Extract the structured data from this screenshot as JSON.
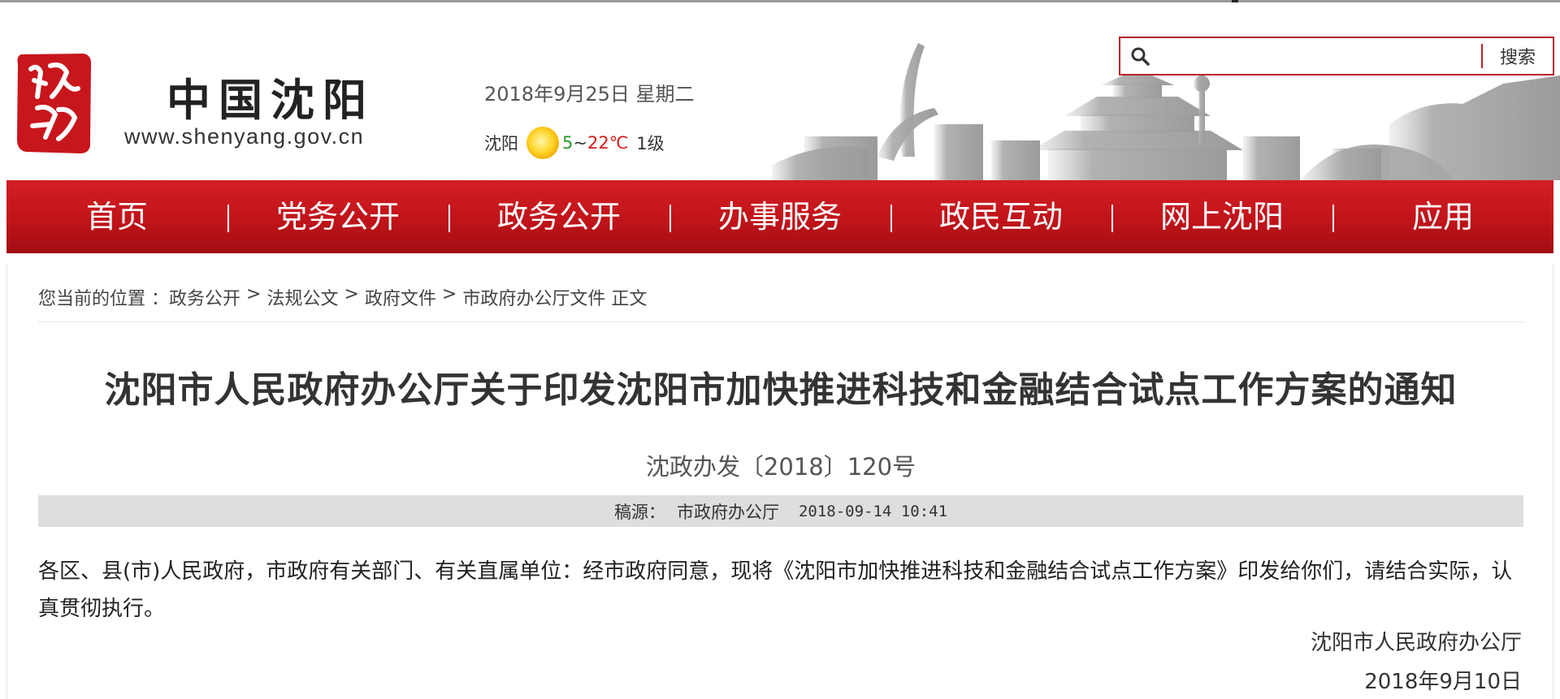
{
  "header": {
    "site_name": "中国沈阳",
    "site_url": "www.shenyang.gov.cn",
    "date": "2018年9月25日 星期二",
    "weather": {
      "city": "沈阳",
      "icon": "sun-icon",
      "temp_low": "5",
      "temp_sep": "~",
      "temp_high": "22℃",
      "wind": "1级"
    },
    "search": {
      "placeholder": "",
      "button_label": "搜索"
    }
  },
  "nav": {
    "items": [
      "首页",
      "党务公开",
      "政务公开",
      "办事服务",
      "政民互动",
      "网上沈阳",
      "应用"
    ]
  },
  "breadcrumb": {
    "prefix": "您当前的位置 ：",
    "items": [
      "政务公开",
      "法规公文",
      "政府文件",
      "市政府办公厅文件"
    ],
    "separator": " > ",
    "current": "正文"
  },
  "article": {
    "title": "沈阳市人民政府办公厅关于印发沈阳市加快推进科技和金融结合试点工作方案的通知",
    "doc_number": "沈政办发〔2018〕120号",
    "source_label": "稿源：",
    "source": "市政府办公厅",
    "published": "2018-09-14 10:41",
    "body": "各区、县(市)人民政府，市政府有关部门、有关直属单位：经市政府同意，现将《沈阳市加快推进科技和金融结合试点工作方案》印发给你们，请结合实际，认真贯彻执行。",
    "signature_org": "沈阳市人民政府办公厅",
    "signature_date": "2018年9月10日"
  },
  "colors": {
    "brand_red": "#c0141a",
    "search_border": "#b8262c",
    "meta_bar": "#dedede"
  }
}
